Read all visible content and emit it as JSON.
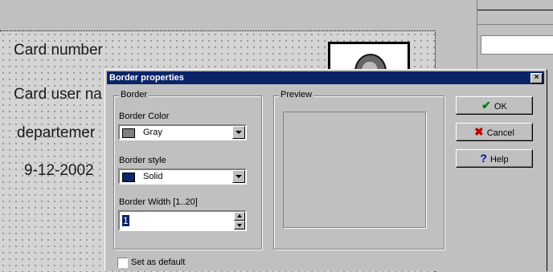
{
  "card": {
    "field1": "Card number",
    "field2": "Card user na",
    "field3": "departemer",
    "field4": "9-12-2002"
  },
  "dialog": {
    "title": "Border properties",
    "close_symbol": "×",
    "border_group": {
      "label": "Border",
      "color_label": "Border Color",
      "color_value": "Gray",
      "color_swatch": "#808080",
      "style_label": "Border style",
      "style_value": "Solid",
      "style_swatch": "#0a246a",
      "width_label": "Border Width [1..20]",
      "width_value": "1"
    },
    "preview_group": {
      "label": "Preview"
    },
    "buttons": {
      "ok": "OK",
      "cancel": "Cancel",
      "help": "Help"
    },
    "set_default_label": "Set as default"
  },
  "icons": {
    "ok_icon": "check-icon",
    "cancel_icon": "x-icon",
    "help_icon": "question-icon"
  },
  "colors": {
    "ok_icon_color": "#008000",
    "cancel_icon_color": "#c00000",
    "help_icon_color": "#0000c0",
    "title_bar": "#0a246a"
  }
}
